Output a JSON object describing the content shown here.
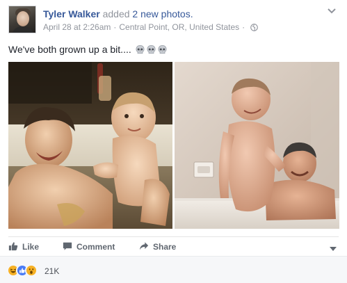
{
  "post": {
    "author": "Tyler Walker",
    "action_text": "added",
    "action_link": "2 new photos.",
    "timestamp": "April 28 at 2:26am",
    "separator": "·",
    "location": "Central Point, OR, United States",
    "separator2": "·",
    "privacy_icon": "globe-icon",
    "text": "We've both grown up a bit....",
    "emojis": [
      "skull-icon",
      "skull-icon",
      "skull-icon"
    ]
  },
  "photos": [
    {
      "name": "photo-father-baby-bathtub"
    },
    {
      "name": "photo-woman-man-bathtub"
    }
  ],
  "actions": {
    "like_label": "Like",
    "comment_label": "Comment",
    "share_label": "Share"
  },
  "reactions": {
    "icons": [
      "haha-icon",
      "like-reaction-icon",
      "wow-icon"
    ],
    "count": "21K"
  },
  "colors": {
    "link": "#365899",
    "muted": "#90949c",
    "action": "#606770",
    "footer_bg": "#f6f7f9"
  }
}
